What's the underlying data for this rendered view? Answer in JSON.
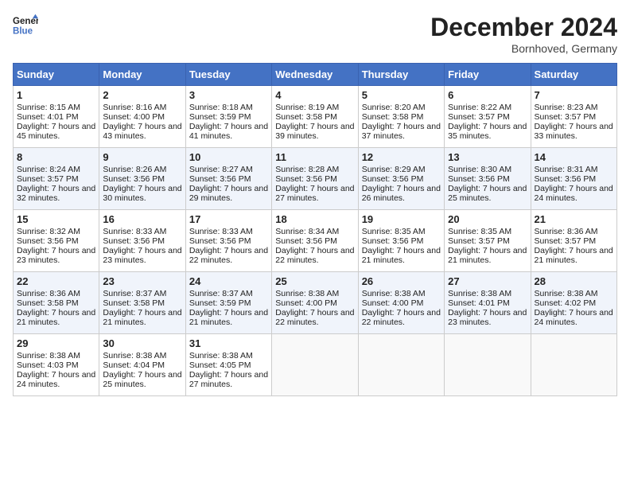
{
  "header": {
    "logo_line1": "General",
    "logo_line2": "Blue",
    "month": "December 2024",
    "location": "Bornhoved, Germany"
  },
  "days_of_week": [
    "Sunday",
    "Monday",
    "Tuesday",
    "Wednesday",
    "Thursday",
    "Friday",
    "Saturday"
  ],
  "weeks": [
    [
      {
        "day": "1",
        "sunrise": "Sunrise: 8:15 AM",
        "sunset": "Sunset: 4:01 PM",
        "daylight": "Daylight: 7 hours and 45 minutes."
      },
      {
        "day": "2",
        "sunrise": "Sunrise: 8:16 AM",
        "sunset": "Sunset: 4:00 PM",
        "daylight": "Daylight: 7 hours and 43 minutes."
      },
      {
        "day": "3",
        "sunrise": "Sunrise: 8:18 AM",
        "sunset": "Sunset: 3:59 PM",
        "daylight": "Daylight: 7 hours and 41 minutes."
      },
      {
        "day": "4",
        "sunrise": "Sunrise: 8:19 AM",
        "sunset": "Sunset: 3:58 PM",
        "daylight": "Daylight: 7 hours and 39 minutes."
      },
      {
        "day": "5",
        "sunrise": "Sunrise: 8:20 AM",
        "sunset": "Sunset: 3:58 PM",
        "daylight": "Daylight: 7 hours and 37 minutes."
      },
      {
        "day": "6",
        "sunrise": "Sunrise: 8:22 AM",
        "sunset": "Sunset: 3:57 PM",
        "daylight": "Daylight: 7 hours and 35 minutes."
      },
      {
        "day": "7",
        "sunrise": "Sunrise: 8:23 AM",
        "sunset": "Sunset: 3:57 PM",
        "daylight": "Daylight: 7 hours and 33 minutes."
      }
    ],
    [
      {
        "day": "8",
        "sunrise": "Sunrise: 8:24 AM",
        "sunset": "Sunset: 3:57 PM",
        "daylight": "Daylight: 7 hours and 32 minutes."
      },
      {
        "day": "9",
        "sunrise": "Sunrise: 8:26 AM",
        "sunset": "Sunset: 3:56 PM",
        "daylight": "Daylight: 7 hours and 30 minutes."
      },
      {
        "day": "10",
        "sunrise": "Sunrise: 8:27 AM",
        "sunset": "Sunset: 3:56 PM",
        "daylight": "Daylight: 7 hours and 29 minutes."
      },
      {
        "day": "11",
        "sunrise": "Sunrise: 8:28 AM",
        "sunset": "Sunset: 3:56 PM",
        "daylight": "Daylight: 7 hours and 27 minutes."
      },
      {
        "day": "12",
        "sunrise": "Sunrise: 8:29 AM",
        "sunset": "Sunset: 3:56 PM",
        "daylight": "Daylight: 7 hours and 26 minutes."
      },
      {
        "day": "13",
        "sunrise": "Sunrise: 8:30 AM",
        "sunset": "Sunset: 3:56 PM",
        "daylight": "Daylight: 7 hours and 25 minutes."
      },
      {
        "day": "14",
        "sunrise": "Sunrise: 8:31 AM",
        "sunset": "Sunset: 3:56 PM",
        "daylight": "Daylight: 7 hours and 24 minutes."
      }
    ],
    [
      {
        "day": "15",
        "sunrise": "Sunrise: 8:32 AM",
        "sunset": "Sunset: 3:56 PM",
        "daylight": "Daylight: 7 hours and 23 minutes."
      },
      {
        "day": "16",
        "sunrise": "Sunrise: 8:33 AM",
        "sunset": "Sunset: 3:56 PM",
        "daylight": "Daylight: 7 hours and 23 minutes."
      },
      {
        "day": "17",
        "sunrise": "Sunrise: 8:33 AM",
        "sunset": "Sunset: 3:56 PM",
        "daylight": "Daylight: 7 hours and 22 minutes."
      },
      {
        "day": "18",
        "sunrise": "Sunrise: 8:34 AM",
        "sunset": "Sunset: 3:56 PM",
        "daylight": "Daylight: 7 hours and 22 minutes."
      },
      {
        "day": "19",
        "sunrise": "Sunrise: 8:35 AM",
        "sunset": "Sunset: 3:56 PM",
        "daylight": "Daylight: 7 hours and 21 minutes."
      },
      {
        "day": "20",
        "sunrise": "Sunrise: 8:35 AM",
        "sunset": "Sunset: 3:57 PM",
        "daylight": "Daylight: 7 hours and 21 minutes."
      },
      {
        "day": "21",
        "sunrise": "Sunrise: 8:36 AM",
        "sunset": "Sunset: 3:57 PM",
        "daylight": "Daylight: 7 hours and 21 minutes."
      }
    ],
    [
      {
        "day": "22",
        "sunrise": "Sunrise: 8:36 AM",
        "sunset": "Sunset: 3:58 PM",
        "daylight": "Daylight: 7 hours and 21 minutes."
      },
      {
        "day": "23",
        "sunrise": "Sunrise: 8:37 AM",
        "sunset": "Sunset: 3:58 PM",
        "daylight": "Daylight: 7 hours and 21 minutes."
      },
      {
        "day": "24",
        "sunrise": "Sunrise: 8:37 AM",
        "sunset": "Sunset: 3:59 PM",
        "daylight": "Daylight: 7 hours and 21 minutes."
      },
      {
        "day": "25",
        "sunrise": "Sunrise: 8:38 AM",
        "sunset": "Sunset: 4:00 PM",
        "daylight": "Daylight: 7 hours and 22 minutes."
      },
      {
        "day": "26",
        "sunrise": "Sunrise: 8:38 AM",
        "sunset": "Sunset: 4:00 PM",
        "daylight": "Daylight: 7 hours and 22 minutes."
      },
      {
        "day": "27",
        "sunrise": "Sunrise: 8:38 AM",
        "sunset": "Sunset: 4:01 PM",
        "daylight": "Daylight: 7 hours and 23 minutes."
      },
      {
        "day": "28",
        "sunrise": "Sunrise: 8:38 AM",
        "sunset": "Sunset: 4:02 PM",
        "daylight": "Daylight: 7 hours and 24 minutes."
      }
    ],
    [
      {
        "day": "29",
        "sunrise": "Sunrise: 8:38 AM",
        "sunset": "Sunset: 4:03 PM",
        "daylight": "Daylight: 7 hours and 24 minutes."
      },
      {
        "day": "30",
        "sunrise": "Sunrise: 8:38 AM",
        "sunset": "Sunset: 4:04 PM",
        "daylight": "Daylight: 7 hours and 25 minutes."
      },
      {
        "day": "31",
        "sunrise": "Sunrise: 8:38 AM",
        "sunset": "Sunset: 4:05 PM",
        "daylight": "Daylight: 7 hours and 27 minutes."
      },
      null,
      null,
      null,
      null
    ]
  ]
}
